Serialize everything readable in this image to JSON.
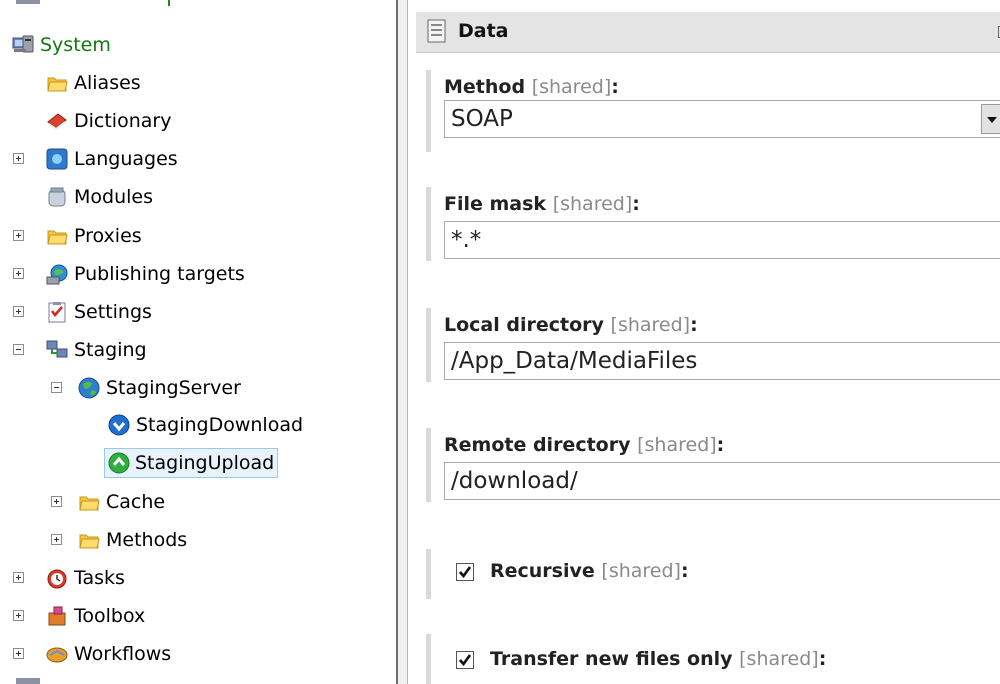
{
  "tree": {
    "items": [
      {
        "label": "System"
      },
      {
        "label": "Aliases"
      },
      {
        "label": "Dictionary"
      },
      {
        "label": "Languages"
      },
      {
        "label": "Modules"
      },
      {
        "label": "Proxies"
      },
      {
        "label": "Publishing targets"
      },
      {
        "label": "Settings"
      },
      {
        "label": "Staging"
      },
      {
        "label": "StagingServer"
      },
      {
        "label": "StagingDownload"
      },
      {
        "label": "StagingUpload"
      },
      {
        "label": "Cache"
      },
      {
        "label": "Methods"
      },
      {
        "label": "Tasks"
      },
      {
        "label": "Toolbox"
      },
      {
        "label": "Workflows"
      }
    ]
  },
  "section": {
    "title": "Data"
  },
  "fields": {
    "shared_tag": "[shared]",
    "colon": ":",
    "method": {
      "label": "Method",
      "value": "SOAP"
    },
    "file_mask": {
      "label": "File mask",
      "value": "*.*"
    },
    "local_dir": {
      "label": "Local directory",
      "value": "/App_Data/MediaFiles"
    },
    "remote_dir": {
      "label": "Remote directory",
      "value": "/download/"
    },
    "recursive": {
      "label": "Recursive",
      "checked": true
    },
    "transfer_new": {
      "label": "Transfer new files only",
      "checked": true
    }
  },
  "colors": {
    "selected_bg": "#e8f2fb",
    "system_green": "#117711"
  }
}
